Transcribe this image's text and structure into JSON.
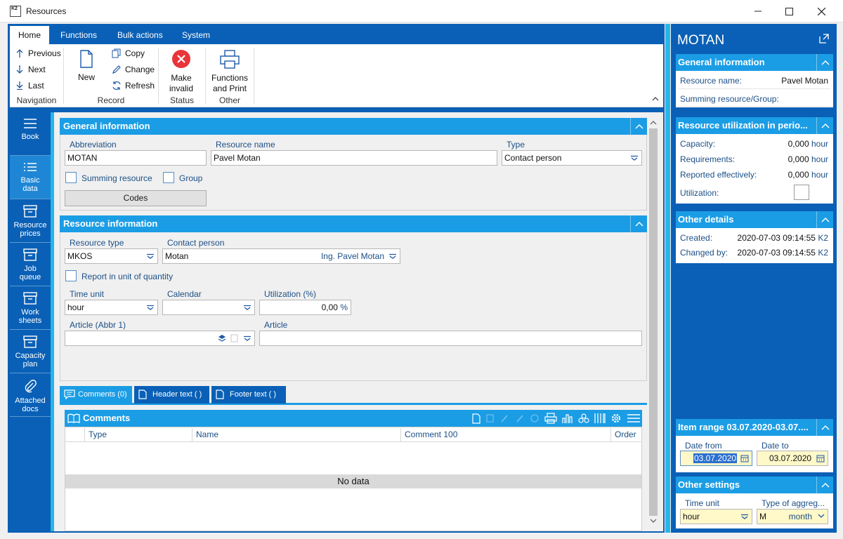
{
  "window": {
    "title": "Resources",
    "logo_text": "K2"
  },
  "ribbon": {
    "tabs": [
      "Home",
      "Functions",
      "Bulk actions",
      "System"
    ],
    "navigation": {
      "previous": "Previous",
      "next": "Next",
      "last": "Last",
      "group": "Navigation"
    },
    "record": {
      "new": "New",
      "copy": "Copy",
      "change": "Change",
      "refresh": "Refresh",
      "group": "Record"
    },
    "status": {
      "make_invalid_1": "Make",
      "make_invalid_2": "invalid",
      "group": "Status"
    },
    "other": {
      "functions_1": "Functions",
      "functions_2": "and Print",
      "group": "Other"
    }
  },
  "leftnav": {
    "items": [
      {
        "label1": "Book",
        "label2": "",
        "icon": "hamburger-icon"
      },
      {
        "label1": "Basic",
        "label2": "data",
        "icon": "list-icon"
      },
      {
        "label1": "Resource",
        "label2": "prices",
        "icon": "box-icon"
      },
      {
        "label1": "Job",
        "label2": "queue",
        "icon": "box-icon"
      },
      {
        "label1": "Work",
        "label2": "sheets",
        "icon": "box-icon"
      },
      {
        "label1": "Capacity",
        "label2": "plan",
        "icon": "box-icon"
      },
      {
        "label1": "Attached",
        "label2": "docs",
        "icon": "paperclip-icon"
      }
    ]
  },
  "general": {
    "title": "General information",
    "abbreviation_label": "Abbreviation",
    "abbreviation": "MOTAN",
    "resource_name_label": "Resource name",
    "resource_name": "Pavel Motan",
    "type_label": "Type",
    "type": "Contact person",
    "summing_resource": "Summing resource",
    "group": "Group",
    "codes": "Codes"
  },
  "resinfo": {
    "title": "Resource information",
    "resource_type_label": "Resource type",
    "resource_type": "MKOS",
    "contact_person_label": "Contact person",
    "contact_person": "Motan",
    "contact_person_name": "Ing. Pavel Motan",
    "report_unit": "Report in unit of quantity",
    "time_unit_label": "Time unit",
    "time_unit": "hour",
    "calendar_label": "Calendar",
    "calendar": "",
    "utilization_label": "Utilization (%)",
    "utilization": "0,00",
    "utilization_unit": "%",
    "article_abbr_label": "Article (Abbr 1)",
    "article_label": "Article"
  },
  "bottom_tabs": [
    "Comments (0)",
    "Header text ( )",
    "Footer text ( )"
  ],
  "comments": {
    "title": "Comments",
    "columns": [
      "Type",
      "Name",
      "Comment 100",
      "Order"
    ],
    "empty": "No data"
  },
  "right": {
    "title": "MOTAN",
    "general_title": "General information",
    "resource_name_label": "Resource name:",
    "resource_name": "Pavel Motan",
    "summing_label": "Summing resource/Group:",
    "util_title": "Resource utilization in perio...",
    "capacity_label": "Capacity:",
    "capacity": "0,000",
    "requirements_label": "Requirements:",
    "requirements": "0,000",
    "reported_label": "Reported effectively:",
    "reported": "0,000",
    "hour_unit": "hour",
    "utilization_label": "Utilization:",
    "other_title": "Other details",
    "created_label": "Created:",
    "created": "2020-07-03 09:14:55",
    "changed_label": "Changed by:",
    "changed": "2020-07-03 09:14:55",
    "user": "K2",
    "range_title": "Item range 03.07.2020-03.07....",
    "date_from_label": "Date from",
    "date_from": "03.07.2020",
    "date_to_label": "Date to",
    "date_to": "03.07.2020",
    "settings_title": "Other settings",
    "time_unit_label": "Time unit",
    "time_unit": "hour",
    "aggreg_label": "Type of aggreg...",
    "aggreg_code": "M",
    "aggreg_value": "month"
  }
}
